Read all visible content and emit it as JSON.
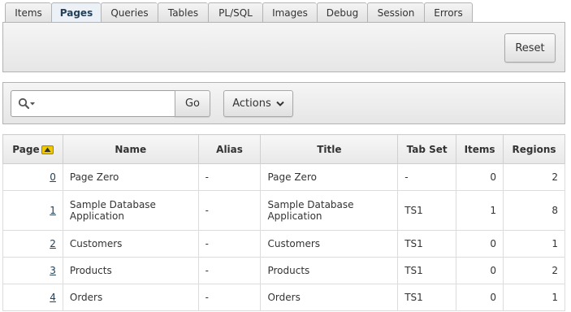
{
  "tabs": [
    {
      "label": "Items"
    },
    {
      "label": "Pages"
    },
    {
      "label": "Queries"
    },
    {
      "label": "Tables"
    },
    {
      "label": "PL/SQL"
    },
    {
      "label": "Images"
    },
    {
      "label": "Debug"
    },
    {
      "label": "Session"
    },
    {
      "label": "Errors"
    }
  ],
  "active_tab": "Pages",
  "reset_panel": {
    "reset_label": "Reset"
  },
  "search": {
    "value": "",
    "placeholder": "",
    "go_label": "Go",
    "actions_label": "Actions"
  },
  "table": {
    "headers": {
      "page": "Page",
      "name": "Name",
      "alias": "Alias",
      "title": "Title",
      "tab_set": "Tab Set",
      "items": "Items",
      "regions": "Regions"
    },
    "rows": [
      {
        "page": "0",
        "name_line1": "Page Zero",
        "name_line2": "",
        "alias": "-",
        "title_line1": "Page Zero",
        "title_line2": "",
        "tab_set": "-",
        "items": "0",
        "regions": "2"
      },
      {
        "page": "1",
        "name_line1": "Sample Database",
        "name_line2": "Application",
        "alias": "-",
        "title_line1": "Sample Database",
        "title_line2": "Application",
        "tab_set": "TS1",
        "items": "1",
        "regions": "8"
      },
      {
        "page": "2",
        "name_line1": "Customers",
        "name_line2": "",
        "alias": "-",
        "title_line1": "Customers",
        "title_line2": "",
        "tab_set": "TS1",
        "items": "0",
        "regions": "1"
      },
      {
        "page": "3",
        "name_line1": "Products",
        "name_line2": "",
        "alias": "-",
        "title_line1": "Products",
        "title_line2": "",
        "tab_set": "TS1",
        "items": "0",
        "regions": "2"
      },
      {
        "page": "4",
        "name_line1": "Orders",
        "name_line2": "",
        "alias": "-",
        "title_line1": "Orders",
        "title_line2": "",
        "tab_set": "TS1",
        "items": "0",
        "regions": "1"
      }
    ]
  },
  "colors": {
    "accent": "#23415b",
    "border": "#b3b3b3",
    "sort_icon": "#f0c800"
  },
  "icons": {
    "search": "search-icon",
    "actions": "chevron-down-icon",
    "sort": "sort-ascending-icon"
  }
}
